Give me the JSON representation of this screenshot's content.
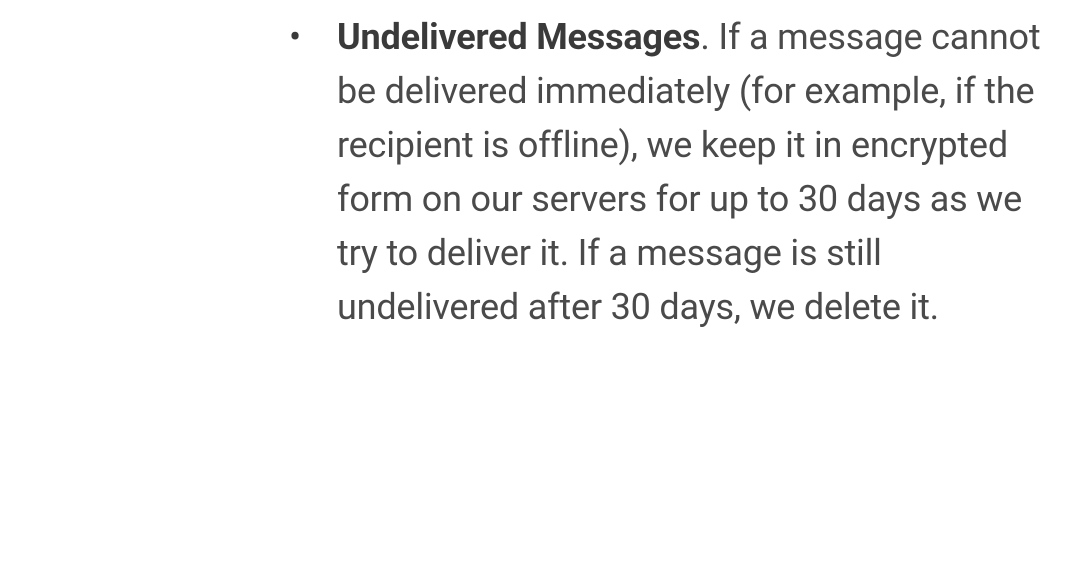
{
  "list": {
    "items": [
      {
        "title": "Undelivered Messages",
        "body": ". If a message cannot be delivered immediately (for example, if the recipient is offline), we keep it in encrypted form on our servers for up to 30 days as we try to deliver it. If a message is still undelivered after 30 days, we delete it."
      }
    ]
  }
}
